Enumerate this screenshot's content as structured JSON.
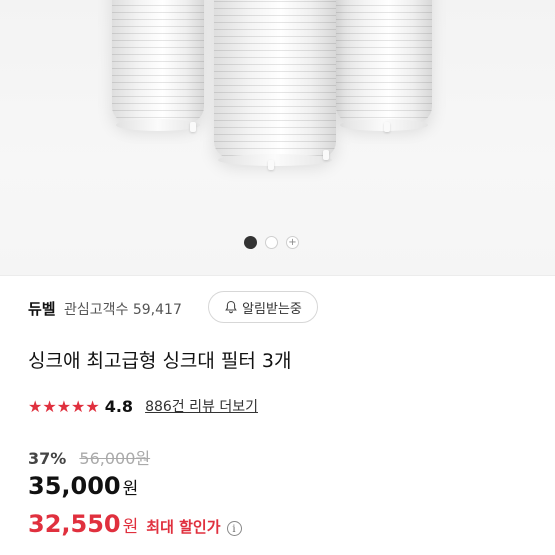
{
  "carousel": {
    "dot_count": 3,
    "active_index": 0
  },
  "store": {
    "brand": "듀벨",
    "interest_label": "관심고객수",
    "interest_count": "59,417",
    "notify_label": "알림받는중"
  },
  "product": {
    "title": "싱크애 최고급형 싱크대 필터 3개"
  },
  "rating": {
    "stars": "★★★★★",
    "score": "4.8",
    "reviews_label": "886건 리뷰 더보기"
  },
  "pricing": {
    "discount_pct": "37%",
    "original_price": "56,000원",
    "sale_amount": "35,000",
    "sale_unit": "원",
    "best_amount": "32,550",
    "best_unit": "원",
    "best_label": "최대 할인가"
  },
  "colors": {
    "accent": "#e0303e",
    "text": "#111111"
  }
}
